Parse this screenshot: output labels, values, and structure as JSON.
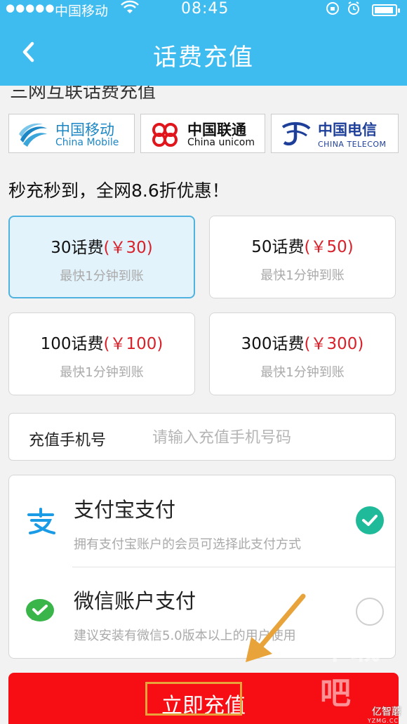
{
  "status_bar": {
    "signal": "●●●●●",
    "carrier": "中国移动",
    "time": "08:45"
  },
  "nav": {
    "title": "话费充值"
  },
  "section_title": "三网互联话费充值",
  "carriers": [
    {
      "cn": "中国移动",
      "en": "China Mobile"
    },
    {
      "cn": "中国联通",
      "en": "China unicom"
    },
    {
      "cn": "中国电信",
      "en": "CHINA TELECOM"
    }
  ],
  "promo": "秒充秒到，全网8.6折优惠！",
  "amounts": [
    {
      "label": "30话费",
      "price": "(￥30)",
      "sub": "最快1分钟到账",
      "selected": true
    },
    {
      "label": "50话费",
      "price": "(￥50)",
      "sub": "最快1分钟到账",
      "selected": false
    },
    {
      "label": "100话费",
      "price": "(￥100)",
      "sub": "最快1分钟到账",
      "selected": false
    },
    {
      "label": "300话费",
      "price": "(￥300)",
      "sub": "最快1分钟到账",
      "selected": false
    }
  ],
  "phone": {
    "label": "充值手机号",
    "placeholder": "请输入充值手机号码"
  },
  "payments": [
    {
      "title": "支付宝支付",
      "desc": "拥有支付宝账户的会员可选择此支付方式",
      "selected": true
    },
    {
      "title": "微信账户支付",
      "desc": "建议安装有微信5.0版本以上的用户使用",
      "selected": false
    }
  ],
  "submit_label": "立即充值",
  "watermark": {
    "main": "下载吧",
    "logo": "亿智蘑",
    "sub": "YZMG.CC"
  },
  "colors": {
    "header": "#3ebcf0",
    "price": "#d7222b",
    "selected_border": "#4fb2df",
    "check": "#1fba9a",
    "submit": "#f70e14",
    "annotation": "#e8a43a"
  }
}
